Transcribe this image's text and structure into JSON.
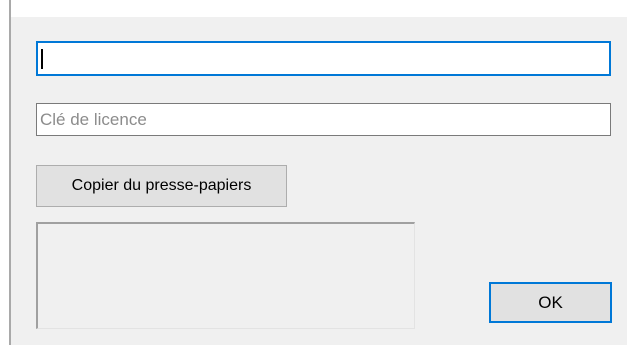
{
  "dialog": {
    "name_field": {
      "value": "",
      "placeholder": ""
    },
    "license_field": {
      "value": "",
      "placeholder": "Clé de licence"
    },
    "copy_button_label": "Copier du presse-papiers",
    "status_text": "",
    "ok_button_label": "OK"
  },
  "colors": {
    "dialog_background": "#f0f0f0",
    "focus_accent": "#0078d7",
    "button_face": "#e1e1e1",
    "placeholder_text": "#8c8c8c"
  }
}
